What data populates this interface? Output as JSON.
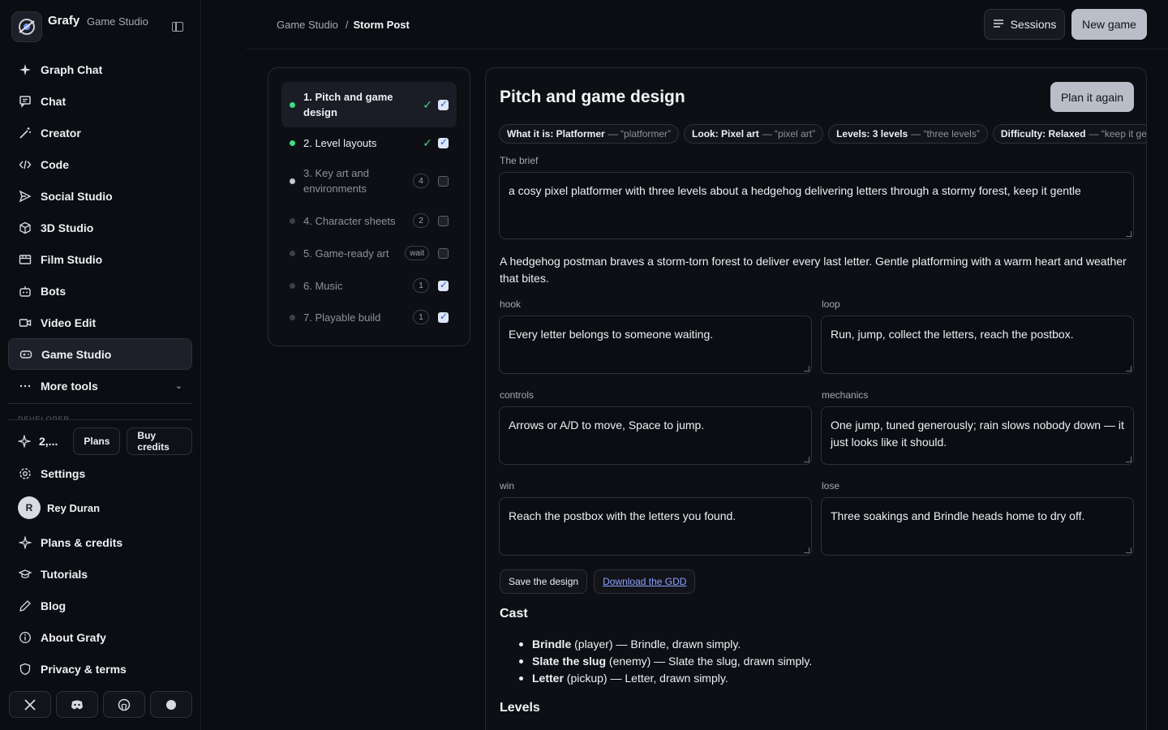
{
  "brand": {
    "name": "Grafy",
    "sub": "Game Studio"
  },
  "sidebar": {
    "items": [
      {
        "label": "Graph Chat",
        "icon": "sparkle-icon"
      },
      {
        "label": "Chat",
        "icon": "chat-icon"
      },
      {
        "label": "Creator",
        "icon": "magic-wand-icon"
      },
      {
        "label": "Code",
        "icon": "code-icon"
      },
      {
        "label": "Social Studio",
        "icon": "send-icon"
      },
      {
        "label": "3D Studio",
        "icon": "cube-icon"
      },
      {
        "label": "Film Studio",
        "icon": "film-icon"
      },
      {
        "label": "Bots",
        "icon": "bot-icon"
      },
      {
        "label": "Video Edit",
        "icon": "video-icon"
      },
      {
        "label": "Game Studio",
        "icon": "gamepad-icon",
        "active": true
      },
      {
        "label": "More tools",
        "icon": "more-icon"
      }
    ],
    "faded_label": "DEVELOPER",
    "credits": {
      "value": "2,...",
      "plans": "Plans",
      "buy": "Buy credits"
    },
    "settings": "Settings",
    "user": {
      "initial": "R",
      "name": "Rey Duran"
    },
    "bottom_items": [
      "Plans & credits",
      "Tutorials",
      "Blog",
      "About Grafy",
      "Privacy & terms"
    ],
    "social": [
      "X",
      "Discord",
      "GitHub",
      "Other"
    ]
  },
  "header": {
    "crumb_root": "Game Studio",
    "crumb_sep": "/",
    "crumb_current": "Storm Post",
    "sessions": "Sessions",
    "new_game": "New game"
  },
  "steps": [
    {
      "label": "1. Pitch and game design",
      "state": "done",
      "tick": "✓",
      "checked": true
    },
    {
      "label": "2. Level layouts",
      "state": "done",
      "tick": "✓",
      "checked": true
    },
    {
      "label": "3. Key art and environments",
      "state": "pending",
      "badge": "4",
      "checked": false
    },
    {
      "label": "4. Character sheets",
      "state": "pending",
      "badge": "2",
      "checked": false
    },
    {
      "label": "5. Game-ready art",
      "state": "pending",
      "badge": "wait",
      "checked": false
    },
    {
      "label": "6. Music",
      "state": "pending",
      "badge": "1",
      "checked": true
    },
    {
      "label": "7. Playable build",
      "state": "pending",
      "badge": "1",
      "checked": true
    }
  ],
  "main": {
    "title": "Pitch and game design",
    "plan_again": "Plan it again",
    "chips": [
      {
        "key": "What it is: Platformer",
        "quote": "— “platformer”"
      },
      {
        "key": "Look: Pixel art",
        "quote": "— “pixel art”"
      },
      {
        "key": "Levels: 3 levels",
        "quote": "— “three levels”"
      },
      {
        "key": "Difficulty: Relaxed",
        "quote": "— “keep it gentle”"
      }
    ],
    "brief_label": "The brief",
    "brief": "a cosy pixel platformer with three levels about a hedgehog delivering letters through a stormy forest, keep it gentle",
    "summary": "A hedgehog postman braves a storm-torn forest to deliver every last letter. Gentle platforming with a warm heart and weather that bites.",
    "fields": {
      "hook_label": "hook",
      "hook": "Every letter belongs to someone waiting.",
      "loop_label": "loop",
      "loop": "Run, jump, collect the letters, reach the postbox.",
      "controls_label": "controls",
      "controls": "Arrows or A/D to move, Space to jump.",
      "mechanics_label": "mechanics",
      "mechanics": "One jump, tuned generously; rain slows nobody down — it just looks like it should.",
      "win_label": "win",
      "win": "Reach the postbox with the letters you found.",
      "lose_label": "lose",
      "lose": "Three soakings and Brindle heads home to dry off."
    },
    "save": "Save the design",
    "download": "Download the GDD",
    "cast_title": "Cast",
    "cast": [
      {
        "name": "Brindle",
        "role": "(player)",
        "desc": "— Brindle, drawn simply."
      },
      {
        "name": "Slate the slug",
        "role": "(enemy)",
        "desc": "— Slate the slug, drawn simply."
      },
      {
        "name": "Letter",
        "role": "(pickup)",
        "desc": "— Letter, drawn simply."
      }
    ],
    "levels_title": "Levels"
  },
  "colors": {
    "accent_green": "#3ddc84",
    "link": "#8ea2ff",
    "bg": "#0b0d12",
    "card": "#0d0f14"
  }
}
